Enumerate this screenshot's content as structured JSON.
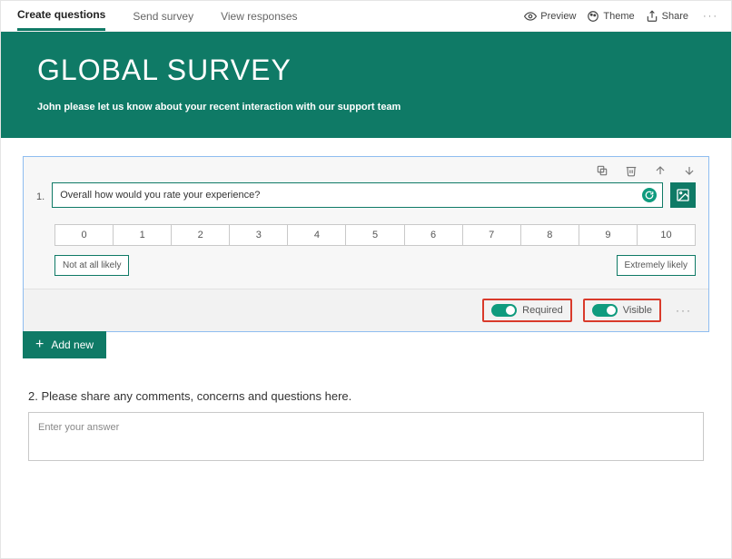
{
  "tabs": {
    "create": "Create questions",
    "send": "Send survey",
    "view": "View responses"
  },
  "actions": {
    "preview": "Preview",
    "theme": "Theme",
    "share": "Share"
  },
  "hero": {
    "title": "GLOBAL SURVEY",
    "subtitle": "John please let us know about your recent interaction with our support team"
  },
  "q1": {
    "number": "1.",
    "text": "Overall how would you rate your experience?",
    "scale": [
      "0",
      "1",
      "2",
      "3",
      "4",
      "5",
      "6",
      "7",
      "8",
      "9",
      "10"
    ],
    "low_label": "Not at all likely",
    "high_label": "Extremely likely",
    "required_label": "Required",
    "visible_label": "Visible"
  },
  "addnew": "Add new",
  "q2": {
    "label": "2. Please share any comments, concerns and questions here.",
    "placeholder": "Enter your answer"
  }
}
